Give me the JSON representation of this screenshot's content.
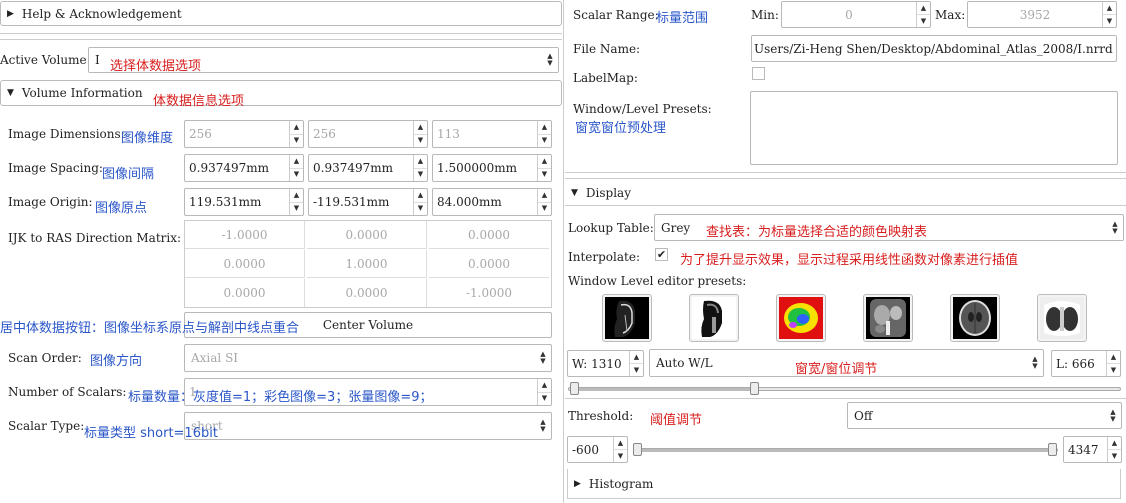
{
  "left": {
    "help_section": "Help & Acknowledgement",
    "active_volume_label": "Active Volume",
    "active_volume_value": "I",
    "active_volume_note": "选择体数据选项",
    "volume_info_section": "Volume Information",
    "volume_info_note": "体数据信息选项",
    "dimensions": {
      "label": "Image Dimensions:",
      "note": "图像维度",
      "values": [
        "256",
        "256",
        "113"
      ]
    },
    "spacing": {
      "label": "Image Spacing:",
      "note": "图像间隔",
      "values": [
        "0.937497mm",
        "0.937497mm",
        "1.500000mm"
      ]
    },
    "origin": {
      "label": "Image Origin:",
      "note": "图像原点",
      "values": [
        "119.531mm",
        "-119.531mm",
        "84.000mm"
      ]
    },
    "matrix": {
      "label": "IJK to RAS Direction Matrix:",
      "rows": [
        [
          "-1.0000",
          "0.0000",
          "0.0000"
        ],
        [
          "0.0000",
          "1.0000",
          "0.0000"
        ],
        [
          "0.0000",
          "0.0000",
          "-1.0000"
        ]
      ]
    },
    "center_note": "居中体数据按钮：图像坐标系原点与解剖中线点重合",
    "center_button": "Center Volume",
    "scan_order": {
      "label": "Scan Order:",
      "note": "图像方向",
      "value": "Axial SI"
    },
    "num_scalars": {
      "label": "Number of Scalars:",
      "note": "标量数量：灰度值=1；彩色图像=3；张量图像=9；",
      "value": "1"
    },
    "scalar_type": {
      "label": "Scalar Type:",
      "note": "标量类型 short=16bit",
      "value": "short"
    }
  },
  "right": {
    "scalar_range_label": "Scalar Range:",
    "scalar_range_note": "标量范围",
    "min_label": "Min:",
    "min_value": "0",
    "max_label": "Max:",
    "max_value": "3952",
    "file_name_label": "File Name:",
    "file_name_value": "Users/Zi-Heng Shen/Desktop/Abdominal_Atlas_2008/I.nrrd",
    "labelmap_label": "LabelMap:",
    "wl_presets_label": "Window/Level Presets:",
    "wl_presets_note": "窗宽窗位预处理",
    "display_section": "Display",
    "lookup_label": "Lookup Table:",
    "lookup_value": "Grey",
    "lookup_note": "查找表：为标量选择合适的颜色映射表",
    "interpolate_label": "Interpolate:",
    "interpolate_note": "为了提升显示效果，显示过程采用线性函数对像素进行插值",
    "wl_editor_label": "Window Level editor presets:",
    "presets": [
      "ct-air",
      "ct-bone",
      "pet-color",
      "ct-abdomen",
      "ct-brain",
      "ct-lung"
    ],
    "window_value": "W: 1310",
    "wl_mode": "Auto W/L",
    "wl_note": "窗宽/窗位调节",
    "level_value": "L: 666",
    "wl_slider": {
      "min": 0,
      "max": 3952,
      "low": 11,
      "high": 1321
    },
    "threshold_label": "Threshold:",
    "threshold_note": "阈值调节",
    "threshold_mode": "Off",
    "threshold_min": "-600",
    "threshold_max": "4347",
    "histogram_section": "Histogram"
  }
}
